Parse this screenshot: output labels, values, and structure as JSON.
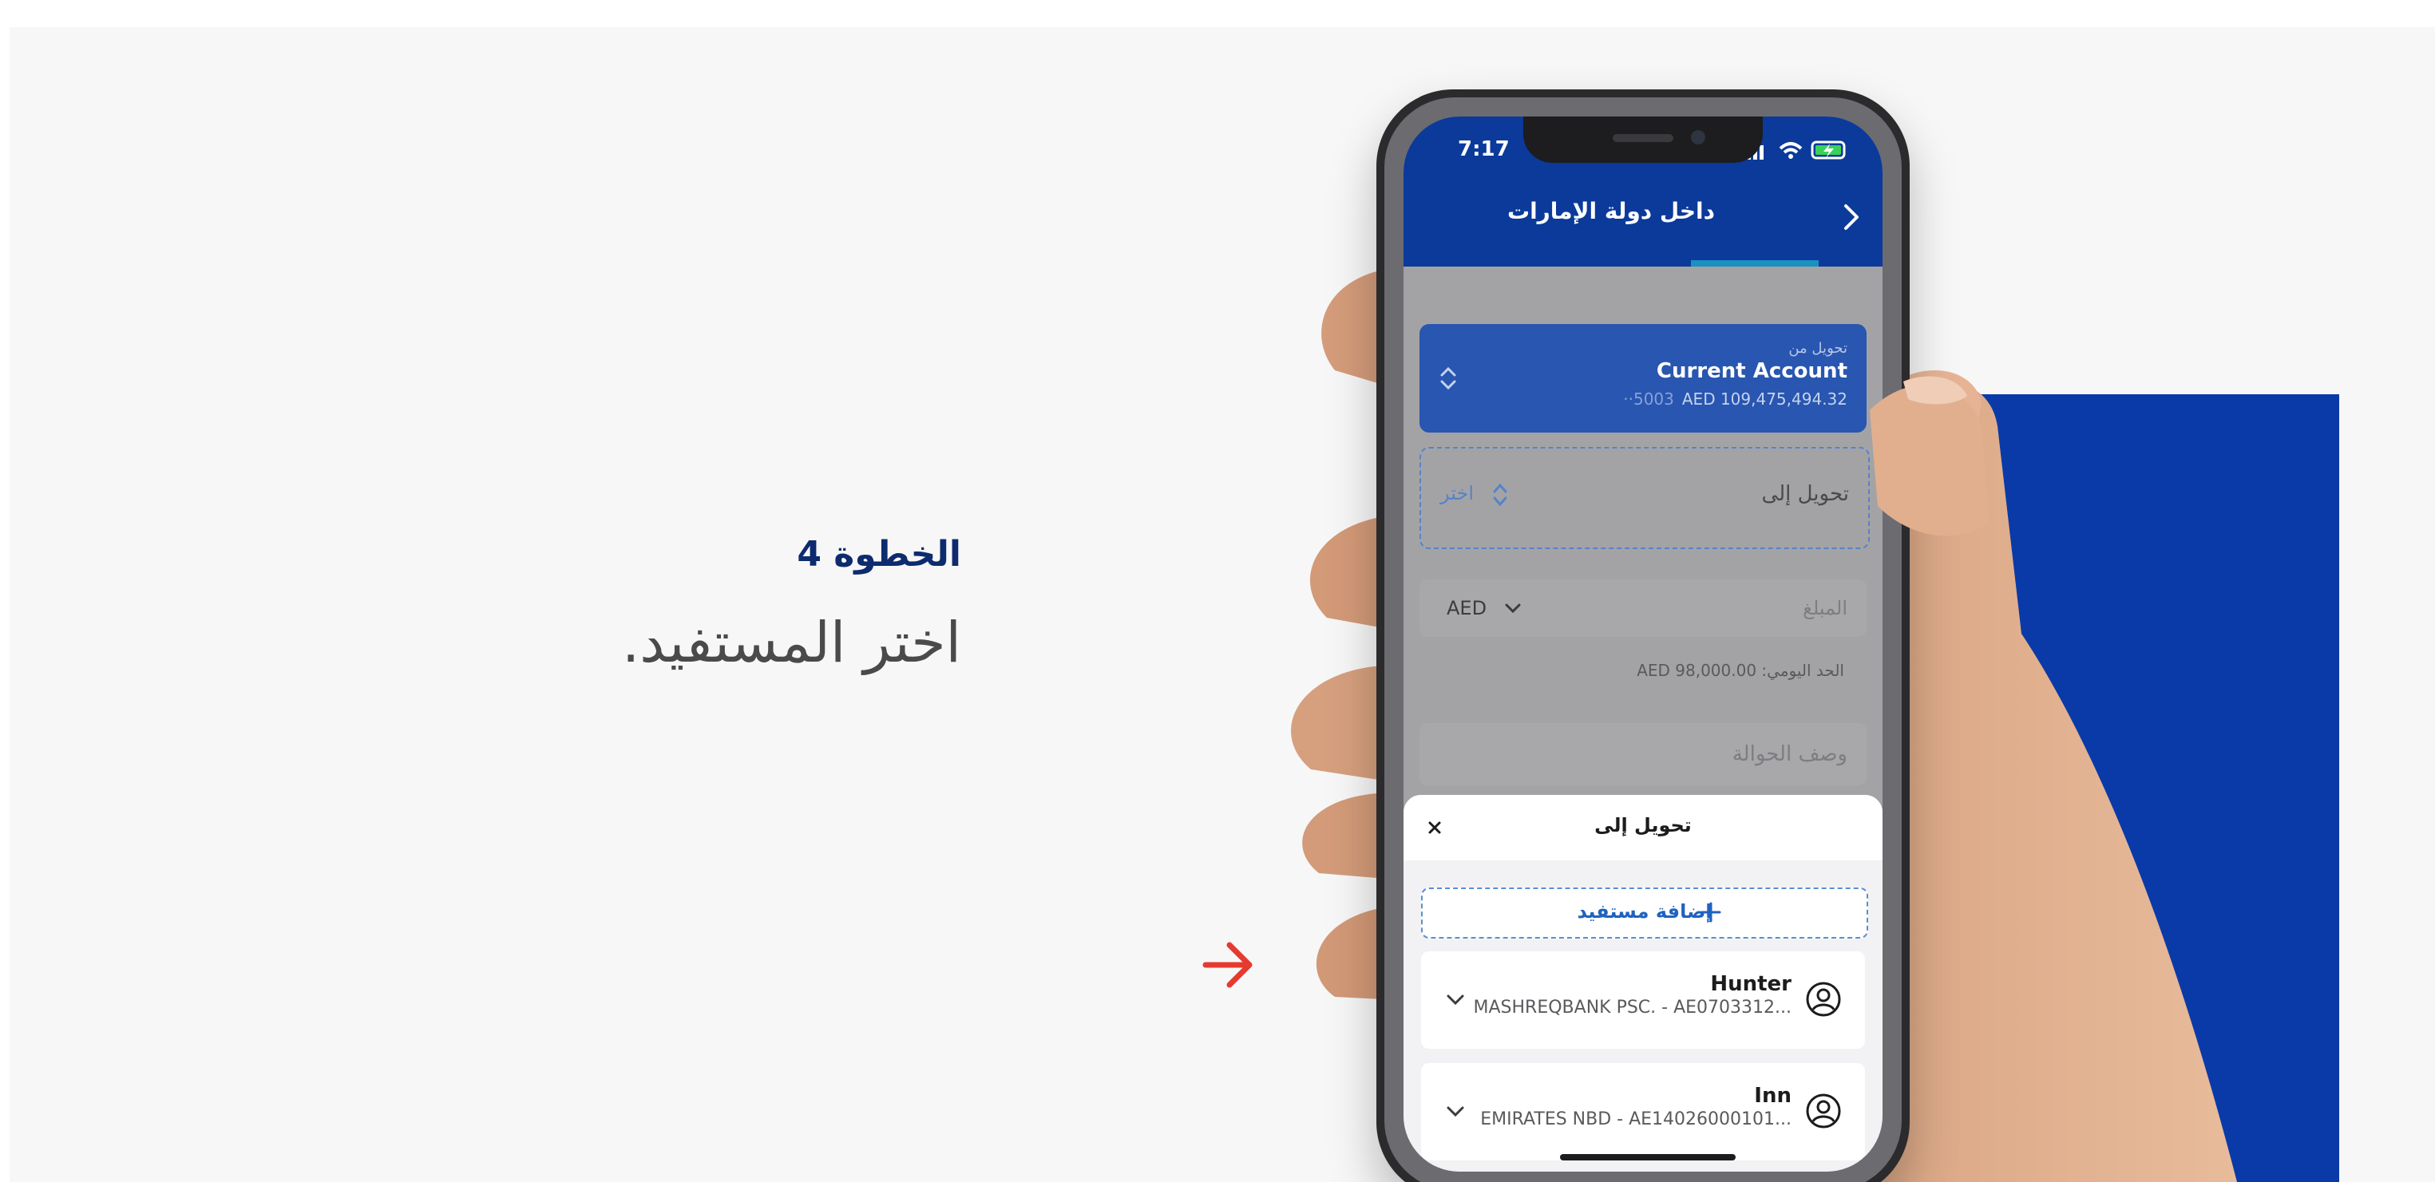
{
  "step": {
    "title": "الخطوة 4",
    "description": "اختر المستفيد."
  },
  "phone": {
    "status": {
      "time": "7:17"
    },
    "nav": {
      "title": "داخل دولة الإمارات"
    },
    "transfer_from": {
      "label": "تحويل من",
      "account": "Current Account",
      "masked_number": "··5003",
      "balance": "AED 109,475,494.32"
    },
    "transfer_to": {
      "label": "تحويل إلى",
      "choose": "اختر"
    },
    "amount": {
      "placeholder": "المبلغ",
      "currency": "AED"
    },
    "daily_limit": "الحد اليومي: AED 98,000.00",
    "transfer_description": {
      "placeholder": "وصف الحوالة"
    },
    "sheet": {
      "title": "تحويل إلى",
      "add_beneficiary": "إضافة مستفيد",
      "beneficiaries": [
        {
          "name": "Hunter",
          "details": "MASHREQBANK PSC. - AE0703312..."
        },
        {
          "name": "Inn",
          "details": "EMIRATES NBD - AE14026000101..."
        }
      ]
    }
  },
  "colors": {
    "brand_blue": "#0a3aa8",
    "step_title": "#0d2b6e",
    "arrow_red": "#e43a2f",
    "link_blue": "#1f63c0"
  },
  "icons": {
    "pointer": "arrow-right-icon",
    "back": "chevron-right-icon",
    "close": "close-icon",
    "add": "plus-icon",
    "avatar": "user-circle-icon",
    "expand": "chevron-down-icon"
  }
}
